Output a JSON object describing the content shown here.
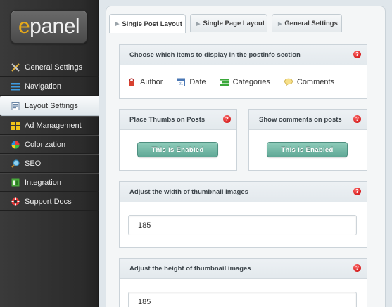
{
  "logo": {
    "first": "e",
    "rest": "panel"
  },
  "nav": [
    {
      "label": "General Settings",
      "icon": "tools-icon"
    },
    {
      "label": "Navigation",
      "icon": "navigation-icon"
    },
    {
      "label": "Layout Settings",
      "icon": "layout-icon",
      "active": true
    },
    {
      "label": "Ad Management",
      "icon": "ad-management-icon"
    },
    {
      "label": "Colorization",
      "icon": "colorization-icon"
    },
    {
      "label": "SEO",
      "icon": "seo-icon"
    },
    {
      "label": "Integration",
      "icon": "integration-icon"
    },
    {
      "label": "Support Docs",
      "icon": "support-icon"
    }
  ],
  "tabs": [
    {
      "label": "Single Post Layout",
      "active": true
    },
    {
      "label": "Single Page Layout"
    },
    {
      "label": "General Settings"
    }
  ],
  "postinfo": {
    "heading": "Choose which items to display in the postinfo section",
    "items": [
      {
        "label": "Author",
        "icon": "author-icon"
      },
      {
        "label": "Date",
        "icon": "date-icon"
      },
      {
        "label": "Categories",
        "icon": "categories-icon"
      },
      {
        "label": "Comments",
        "icon": "comments-icon"
      }
    ]
  },
  "thumbs": {
    "heading": "Place Thumbs on Posts",
    "button": "This is Enabled"
  },
  "comments": {
    "heading": "Show comments on posts",
    "button": "This is Enabled"
  },
  "thumb_width": {
    "heading": "Adjust the width of thumbnail images",
    "value": "185"
  },
  "thumb_height": {
    "heading": "Adjust the height of thumbnail images",
    "value": "185"
  },
  "help_glyph": "?",
  "colors": {
    "accent": "#6fb4a2",
    "help": "#cc0000",
    "sidebar": "#2f2f2f",
    "logo_e": "#e6a91a"
  }
}
